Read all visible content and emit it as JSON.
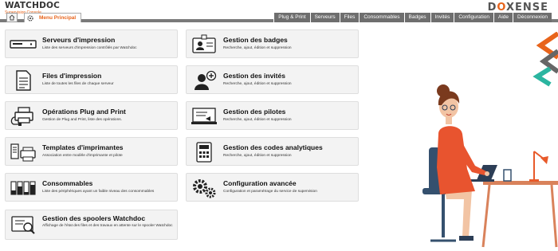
{
  "header": {
    "logo_name": "WATCHDOC",
    "logo_sub": "Supervision Console",
    "brand_prefix": "D",
    "brand_o": "O",
    "brand_suffix": "XENSE",
    "menu_tab": "Menu Principal",
    "nav": [
      "Plug & Print",
      "Serveurs",
      "Files",
      "Consommables",
      "Badges",
      "Invités",
      "Configuration",
      "Aide",
      "Déconnexion"
    ]
  },
  "cards": {
    "servers": {
      "title": "Serveurs d'impression",
      "desc": "Liste des serveurs d'impression contrôlés par Watchdoc"
    },
    "queues": {
      "title": "Files d'impression",
      "desc": "Liste de toutes les files de chaque serveur"
    },
    "plugprint": {
      "title": "Opérations Plug and Print",
      "desc": "Gestion de Plug and Print, liste des opérations."
    },
    "templates": {
      "title": "Templates d'imprimantes",
      "desc": "Association entre modèle d'imprimante et pilote"
    },
    "consumables": {
      "title": "Consommables",
      "desc": "Liste des périphériques ayant un faible niveau des consommables"
    },
    "spoolers": {
      "title": "Gestion des spoolers Watchdoc",
      "desc": "Affichage de l'état des files et des travaux en attente sur le spooler Watchdoc"
    },
    "badges": {
      "title": "Gestion des badges",
      "desc": "Recherche, ajout, édition et suppression"
    },
    "guests": {
      "title": "Gestion des invités",
      "desc": "Recherche, ajout, édition et suppression"
    },
    "drivers": {
      "title": "Gestion des pilotes",
      "desc": "Recherche, ajout, édition et suppression"
    },
    "codes": {
      "title": "Gestion des codes analytiques",
      "desc": "Recherche, ajout, édition et suppression"
    },
    "config": {
      "title": "Configuration avancée",
      "desc": "Configuration et paramétrage du service de supervision"
    }
  },
  "colors": {
    "accent": "#e8641b",
    "nav_bg": "#6e6e6e",
    "card_bg": "#f3f3f3",
    "teal": "#2bb5a0",
    "grey": "#666666"
  },
  "icons": [
    "home-icon",
    "menu-principal-icon",
    "server-icon",
    "files-icon",
    "plug-print-icon",
    "printer-templates-icon",
    "consumables-icon",
    "spooler-icon",
    "badge-icon",
    "add-user-icon",
    "driver-icon",
    "calculator-icon",
    "gears-icon"
  ]
}
